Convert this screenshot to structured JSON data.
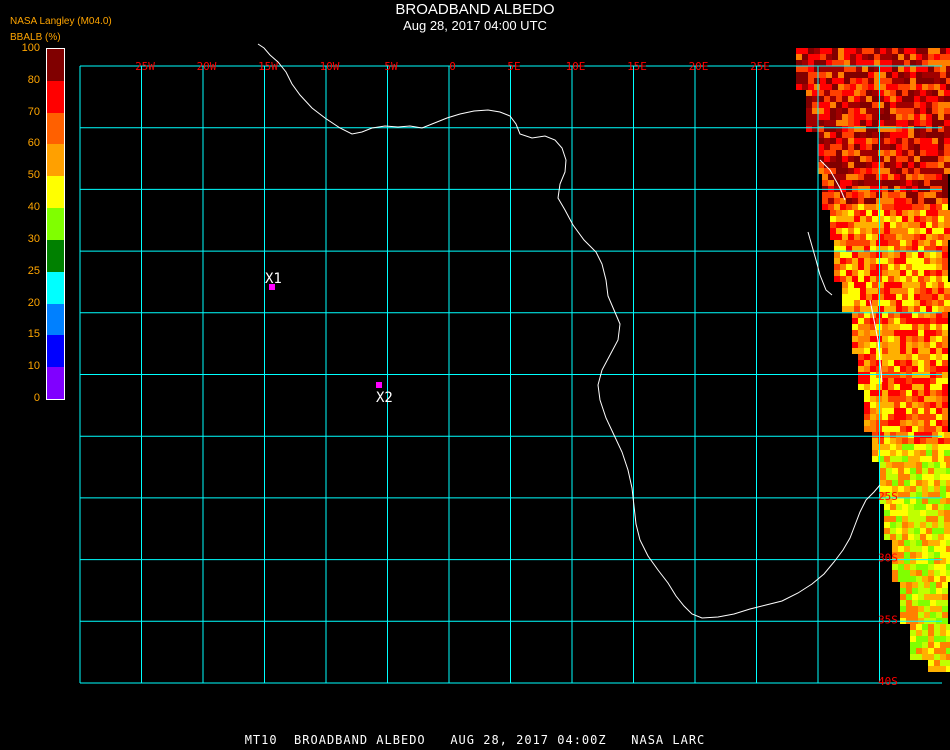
{
  "header": {
    "title": "BROADBAND ALBEDO",
    "subtitle": "Aug 28, 2017 04:00 UTC",
    "credit": "NASA Langley (M04.0)"
  },
  "colorbar": {
    "label": "BBALB (%)",
    "ticks": [
      "100",
      "80",
      "70",
      "60",
      "50",
      "40",
      "30",
      "25",
      "20",
      "15",
      "10",
      "0"
    ],
    "colors": [
      "#800000",
      "#ff0000",
      "#ff6000",
      "#ffa000",
      "#ffff00",
      "#80ff00",
      "#008000",
      "#00ffff",
      "#0080ff",
      "#0000ff",
      "#8000ff"
    ]
  },
  "map": {
    "lon_labels": [
      "25W",
      "20W",
      "15W",
      "10W",
      "5W",
      "0",
      "5E",
      "10E",
      "15E",
      "20E",
      "25E"
    ],
    "lat_labels": [
      "25S",
      "30S",
      "35S",
      "40S"
    ],
    "markers": [
      {
        "id": "X1",
        "label": "X1"
      },
      {
        "id": "X2",
        "label": "X2"
      }
    ],
    "grid_color": "#00ffff",
    "label_color": "#ff0000",
    "marker_color": "#ff00ff"
  },
  "footer": "MT10  BROADBAND ALBEDO   AUG 28, 2017 04:00Z   NASA LARC"
}
